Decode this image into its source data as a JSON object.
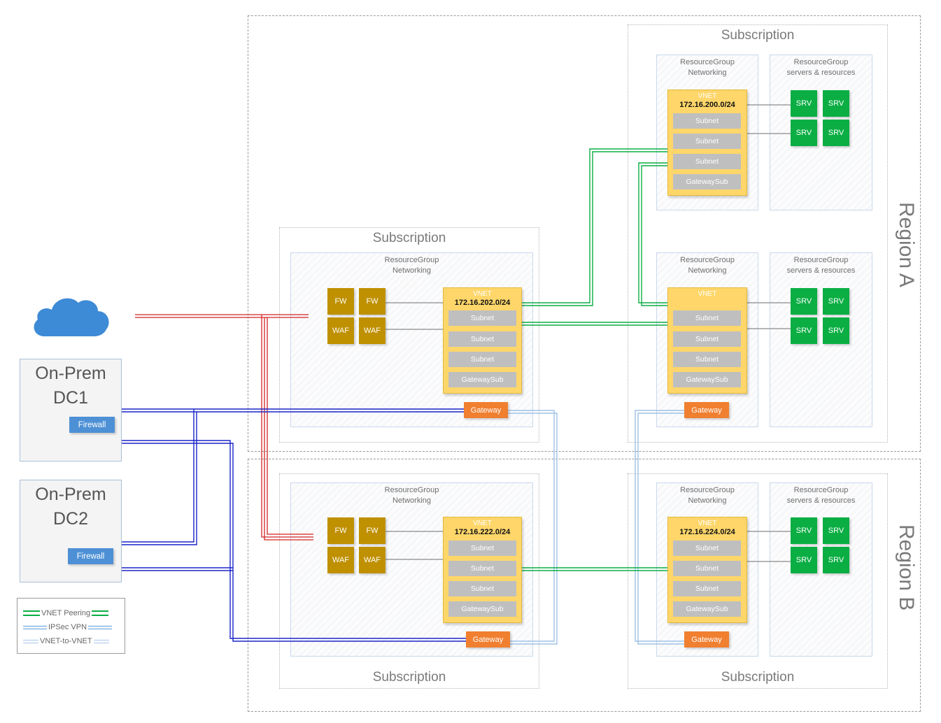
{
  "regions": [
    {
      "id": "a",
      "label": "Region A"
    },
    {
      "id": "b",
      "label": "Region B"
    }
  ],
  "subscription_title": "Subscription",
  "rg_networking_title": "ResourceGroup\nNetworking",
  "rg_servers_title": "ResourceGroup\nservers & resources",
  "vnet_tag": "VNET",
  "labels": {
    "subnet": "Subnet",
    "gatewaysub": "GatewaySub",
    "gateway": "Gateway",
    "fw": "FW",
    "waf": "WAF",
    "srv": "SRV",
    "firewall": "Firewall"
  },
  "vnets": {
    "top_right": {
      "cidr": "172.16.200.0/24"
    },
    "hub_a": {
      "cidr": "172.16.202.0/24"
    },
    "mid_right": {
      "cidr": ""
    },
    "hub_b": {
      "cidr": "172.16.222.0/24"
    },
    "bottom_right": {
      "cidr": "172.16.224.0/24"
    }
  },
  "datacenters": [
    {
      "label": "On-Prem\nDC1"
    },
    {
      "label": "On-Prem\nDC2"
    }
  ],
  "legend": [
    {
      "label": "VNET Peering",
      "color": "#0aae43"
    },
    {
      "label": "IPSec VPN",
      "color": "#5b9bd5"
    },
    {
      "label": "VNET-to-VNET",
      "color": "#a9c8ec"
    }
  ],
  "colors": {
    "internet_line": "#d42222",
    "vpn_line": "#1a24c9",
    "peering_line": "#0aae43",
    "v2v_line": "#9ec2e6",
    "cloud": "#3d8ad6"
  }
}
